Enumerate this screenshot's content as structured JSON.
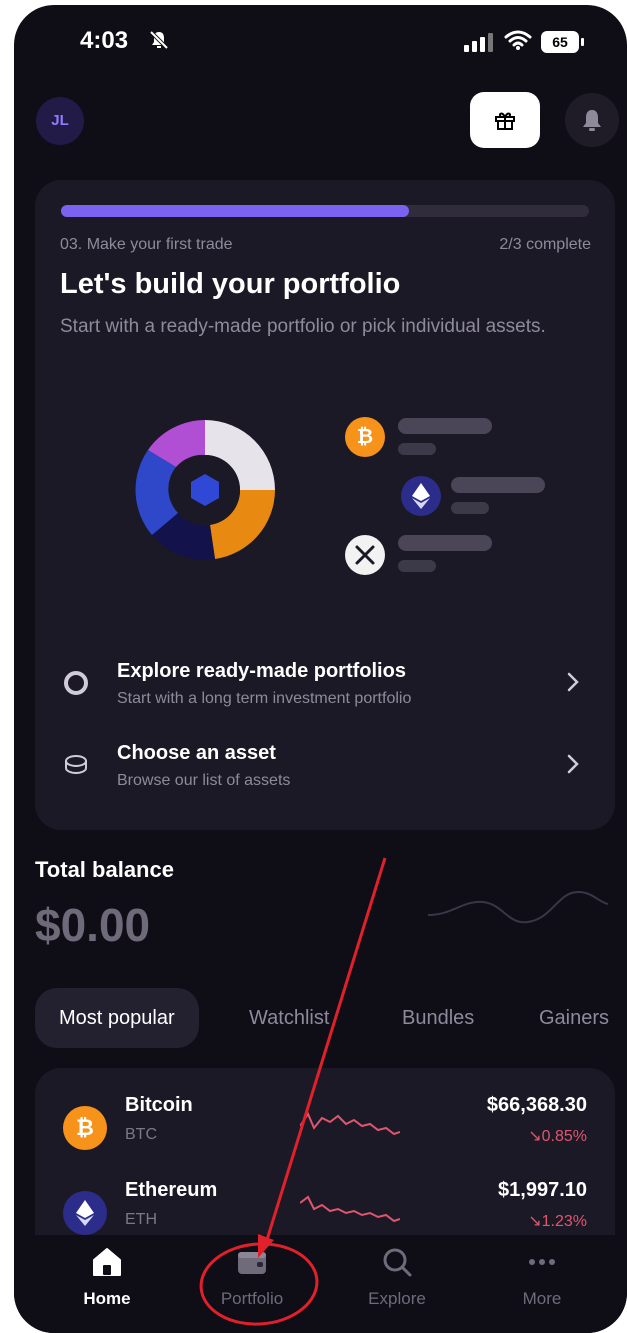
{
  "status_bar": {
    "time": "4:03",
    "battery": "65"
  },
  "header": {
    "avatar_initials": "JL"
  },
  "onboarding": {
    "progress": 0.66,
    "step_label": "03. Make your first trade",
    "step_count": "2/3 complete",
    "title": "Let's build your portfolio",
    "subtitle": "Start with a ready-made portfolio or pick individual assets.",
    "options": [
      {
        "title": "Explore ready-made portfolios",
        "description": "Start with a long term investment portfolio"
      },
      {
        "title": "Choose an asset",
        "description": "Browse our list of assets"
      }
    ]
  },
  "balance": {
    "label": "Total balance",
    "value": "$0.00"
  },
  "tabs": [
    "Most popular",
    "Watchlist",
    "Bundles",
    "Gainers"
  ],
  "assets": [
    {
      "name": "Bitcoin",
      "symbol": "BTC",
      "price": "$66,368.30",
      "change": "0.85%"
    },
    {
      "name": "Ethereum",
      "symbol": "ETH",
      "price": "$1,997.10",
      "change": "1.23%"
    }
  ],
  "nav": [
    "Home",
    "Portfolio",
    "Explore",
    "More"
  ],
  "colors": {
    "accent": "#7b63ef",
    "background": "#0f0d15",
    "card": "#1c1926",
    "negative": "#e0566e",
    "bitcoin": "#f7931a",
    "annotation": "#e0202a"
  }
}
